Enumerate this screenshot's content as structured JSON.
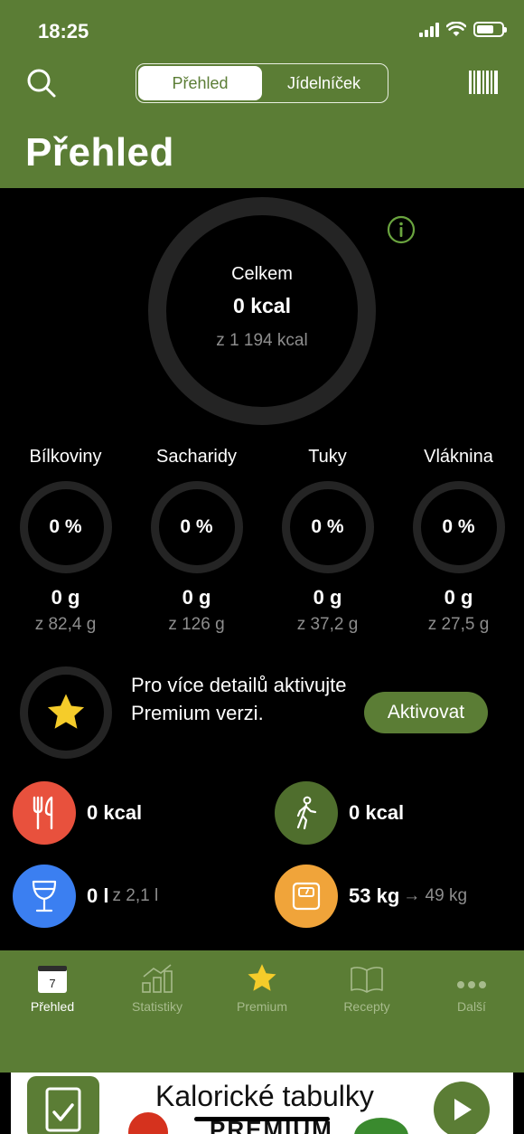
{
  "status_bar": {
    "time": "18:25"
  },
  "header": {
    "segments": [
      "Přehled",
      "Jídelníček"
    ],
    "active_segment": 0,
    "title": "Přehled"
  },
  "summary": {
    "label": "Celkem",
    "value": "0 kcal",
    "goal": "z 1 194 kcal",
    "progress": 0
  },
  "macros": [
    {
      "name": "Bílkoviny",
      "percent": "0 %",
      "grams": "0 g",
      "goal": "z 82,4 g"
    },
    {
      "name": "Sacharidy",
      "percent": "0 %",
      "grams": "0 g",
      "goal": "z 126 g"
    },
    {
      "name": "Tuky",
      "percent": "0 %",
      "grams": "0 g",
      "goal": "z 37,2 g"
    },
    {
      "name": "Vláknina",
      "percent": "0 %",
      "grams": "0 g",
      "goal": "z 27,5 g"
    }
  ],
  "premium": {
    "text": "Pro více detailů aktivujte Premium verzi.",
    "button": "Aktivovat"
  },
  "stats": {
    "food": {
      "value": "0 kcal",
      "icon": "fork-knife-icon",
      "color": "#e8513d"
    },
    "activity": {
      "value": "0 kcal",
      "icon": "walking-icon",
      "color": "#4f6e2d"
    },
    "drink": {
      "value": "0 l",
      "sub": "z 2,1 l",
      "icon": "glass-icon",
      "color": "#3b7ff1"
    },
    "weight": {
      "value": "53 kg",
      "sub": "→ 49 kg",
      "icon": "scale-icon",
      "color": "#f0a43a"
    }
  },
  "tabbar": {
    "tabs": [
      {
        "label": "Přehled",
        "icon": "calendar-icon",
        "day": "7",
        "active": true
      },
      {
        "label": "Statistiky",
        "icon": "chart-icon",
        "active": false
      },
      {
        "label": "Premium",
        "icon": "star-icon",
        "active": false
      },
      {
        "label": "Recepty",
        "icon": "book-icon",
        "active": false
      },
      {
        "label": "Další",
        "icon": "more-icon",
        "active": false
      }
    ]
  },
  "banner": {
    "title": "Kalorické tabulky",
    "subtitle": "PREMIUM"
  },
  "colors": {
    "brand_green": "#5b7d35",
    "star_yellow": "#f5cc2a",
    "ring_track": "#242424"
  }
}
